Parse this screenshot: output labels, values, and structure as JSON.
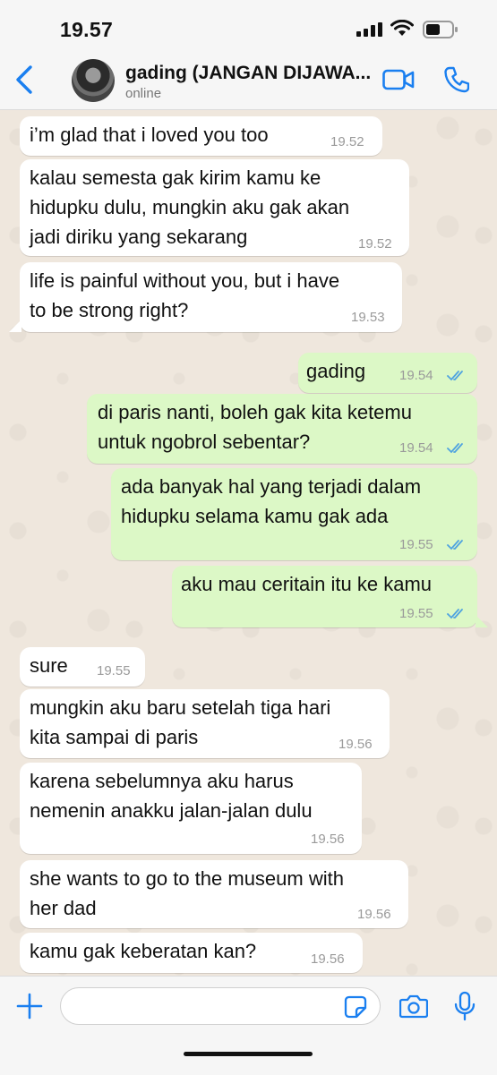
{
  "status_bar": {
    "time": "19.57"
  },
  "header": {
    "contact_name": "gading (JANGAN DIJAWA...",
    "contact_status": "online"
  },
  "messages": [
    {
      "direction": "incoming",
      "text": "i’m glad that i loved you too",
      "time": "19.52"
    },
    {
      "direction": "incoming",
      "text": "kalau semesta gak kirim kamu ke\nhidupku dulu, mungkin aku gak akan\njadi diriku yang sekarang",
      "time": "19.52"
    },
    {
      "direction": "incoming",
      "text": "life is painful without you, but i have\nto be strong right?",
      "time": "19.53"
    },
    {
      "direction": "outgoing",
      "text": "gading",
      "time": "19.54",
      "read": true
    },
    {
      "direction": "outgoing",
      "text": "di paris nanti, boleh gak kita ketemu\nuntuk ngobrol sebentar?",
      "time": "19.54",
      "read": true
    },
    {
      "direction": "outgoing",
      "text": "ada banyak hal yang terjadi dalam\nhidupku selama kamu gak ada",
      "time": "19.55",
      "read": true
    },
    {
      "direction": "outgoing",
      "text": "aku mau ceritain itu ke kamu",
      "time": "19.55",
      "read": true
    },
    {
      "direction": "incoming",
      "text": "sure",
      "time": "19.55"
    },
    {
      "direction": "incoming",
      "text": "mungkin aku baru setelah tiga hari\nkita sampai di paris",
      "time": "19.56"
    },
    {
      "direction": "incoming",
      "text": "karena sebelumnya aku harus\nnemenin anakku jalan-jalan dulu",
      "time": "19.56"
    },
    {
      "direction": "incoming",
      "text": "she wants to go to the museum with\nher dad",
      "time": "19.56"
    },
    {
      "direction": "incoming",
      "text": "kamu gak keberatan kan?",
      "time": "19.56"
    }
  ],
  "composer": {
    "input_value": "",
    "input_placeholder": ""
  },
  "icons": {
    "back": "chevron-left-icon",
    "video_call": "video-camera-icon",
    "voice_call": "phone-icon",
    "attach": "plus-icon",
    "sticker": "sticker-icon",
    "camera": "camera-icon",
    "mic": "microphone-icon",
    "read_receipt": "double-check-icon"
  },
  "colors": {
    "accent": "#1a7ff0",
    "incoming_bubble": "#ffffff",
    "outgoing_bubble": "#dcf8c6",
    "chat_background": "#efe7dd",
    "read_tick": "#4fa3e0"
  }
}
